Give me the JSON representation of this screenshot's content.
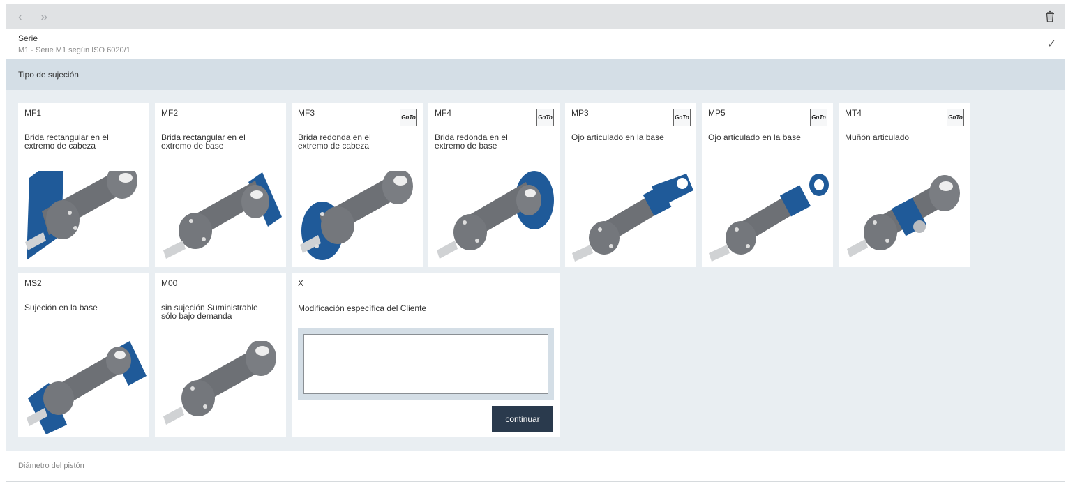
{
  "topbar": {
    "back_icon": "chevron-left-icon",
    "forward_icon": "double-chevron-right-icon",
    "trash_icon": "trash-icon"
  },
  "serie": {
    "label": "Serie",
    "value": "M1 - Serie M1 según ISO 6020/1",
    "check_icon": "check-icon"
  },
  "section": {
    "title": "Tipo de sujeción"
  },
  "colors": {
    "accent_blue": "#1f5a99",
    "cylinder_grey": "#6d7075",
    "button_dark": "#2a3a4d"
  },
  "cards": [
    {
      "code": "MF1",
      "desc": "Brida rectangular en el extremo de cabeza",
      "goto": ""
    },
    {
      "code": "MF2",
      "desc": "Brida rectangular en el extremo de base",
      "goto": ""
    },
    {
      "code": "MF3",
      "desc": "Brida redonda en el extremo de cabeza",
      "goto": "GoTo"
    },
    {
      "code": "MF4",
      "desc": "Brida redonda en el extremo de base",
      "goto": "GoTo"
    },
    {
      "code": "MP3",
      "desc": "Ojo articulado en la base",
      "goto": "GoTo"
    },
    {
      "code": "MP5",
      "desc": "Ojo articulado en la base",
      "goto": "GoTo"
    },
    {
      "code": "MT4",
      "desc": "Muñón articulado",
      "goto": "GoTo"
    },
    {
      "code": "MS2",
      "desc": "Sujeción en la base",
      "goto": ""
    },
    {
      "code": "M00",
      "desc": "sin sujeción Suministrable sólo bajo demanda",
      "goto": ""
    }
  ],
  "custom": {
    "code": "X",
    "desc": "Modificación específica del Cliente",
    "textarea_value": "",
    "button_label": "continuar"
  },
  "footer": {
    "label": "Diámetro del pistón"
  }
}
